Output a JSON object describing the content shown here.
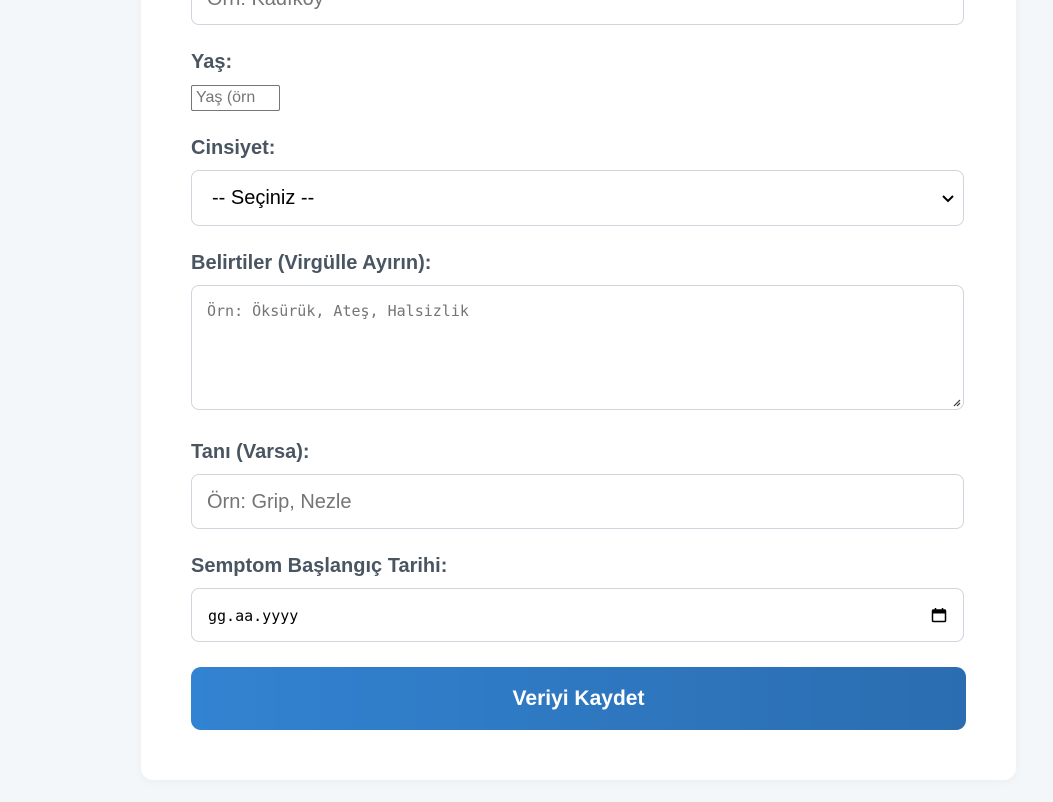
{
  "form": {
    "district_placeholder": "Örn: Kadıköy",
    "age_label": "Yaş:",
    "age_placeholder": "Yaş (örn",
    "gender_label": "Cinsiyet:",
    "gender_selected": "-- Seçiniz --",
    "symptoms_label": "Belirtiler (Virgülle Ayırın):",
    "symptoms_placeholder": "Örn: Öksürük, Ateş, Halsizlik",
    "diagnosis_label": "Tanı (Varsa):",
    "diagnosis_placeholder": "Örn: Grip, Nezle",
    "date_label": "Semptom Başlangıç Tarihi:",
    "date_placeholder": "gg.aa.yyyy",
    "submit_label": "Veriyi Kaydet"
  },
  "icons": {
    "select": "chevron-down-icon",
    "date": "calendar-icon",
    "textarea": "resize-handle-icon"
  },
  "colors": {
    "button_start": "#3283d2",
    "button_end": "#2b6db0",
    "label": "#4a5562"
  }
}
